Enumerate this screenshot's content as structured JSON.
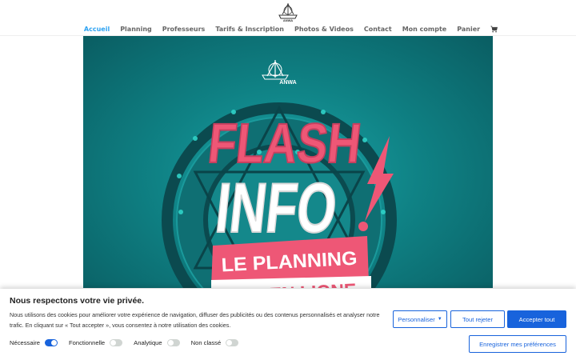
{
  "nav": {
    "items": [
      "Accueil",
      "Planning",
      "Professeurs",
      "Tarifs & Inscription",
      "Photos & Videos",
      "Contact",
      "Mon compte",
      "Panier"
    ],
    "active_index": 0,
    "cart_icon": "cart-icon"
  },
  "logo": {
    "text": "ANWA"
  },
  "hero": {
    "brand": "ANWA",
    "line1": "FLASH",
    "line2": "INFO",
    "line3": "LE PLANNING",
    "line4": "EST EN LIGNE"
  },
  "cookie": {
    "title": "Nous respectons votre vie privée.",
    "body": "Nous utilisons des cookies pour améliorer votre expérience de navigation, diffuser des publicités ou des contenus personnalisés et analyser notre trafic. En cliquant sur « Tout accepter », vous consentez à notre utilisation des cookies.",
    "customize_label": "Personnaliser",
    "reject_label": "Tout rejeter",
    "accept_label": "Accepter tout",
    "save_label": "Enregistrer mes préférences",
    "toggles": [
      {
        "label": "Nécessaire",
        "on": true
      },
      {
        "label": "Fonctionnelle",
        "on": false
      },
      {
        "label": "Analytique",
        "on": false
      },
      {
        "label": "Non classé",
        "on": false
      }
    ]
  },
  "colors": {
    "accent": "#1863dc",
    "nav_active": "#2ea3f2",
    "pink": "#ee5776",
    "teal": "#0f8285"
  }
}
